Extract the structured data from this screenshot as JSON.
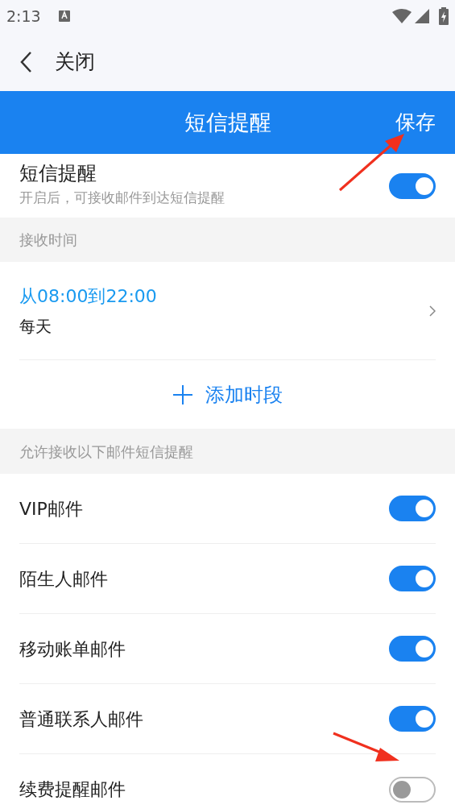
{
  "status_bar": {
    "time": "2:13"
  },
  "nav": {
    "back_label": "关闭"
  },
  "header": {
    "title": "短信提醒",
    "action": "保存"
  },
  "main_switch": {
    "title": "短信提醒",
    "subtitle": "开启后，可接收邮件到达短信提醒",
    "on": true
  },
  "receive_time": {
    "section_title": "接收时间",
    "periods": [
      {
        "range": "从08:00到22:00",
        "repeat": "每天"
      }
    ],
    "add_button": "添加时段"
  },
  "mail_types": {
    "section_title": "允许接收以下邮件短信提醒",
    "items": [
      {
        "label": "VIP邮件",
        "on": true
      },
      {
        "label": "陌生人邮件",
        "on": true
      },
      {
        "label": "移动账单邮件",
        "on": true
      },
      {
        "label": "普通联系人邮件",
        "on": true
      },
      {
        "label": "续费提醒邮件",
        "on": false
      }
    ]
  }
}
